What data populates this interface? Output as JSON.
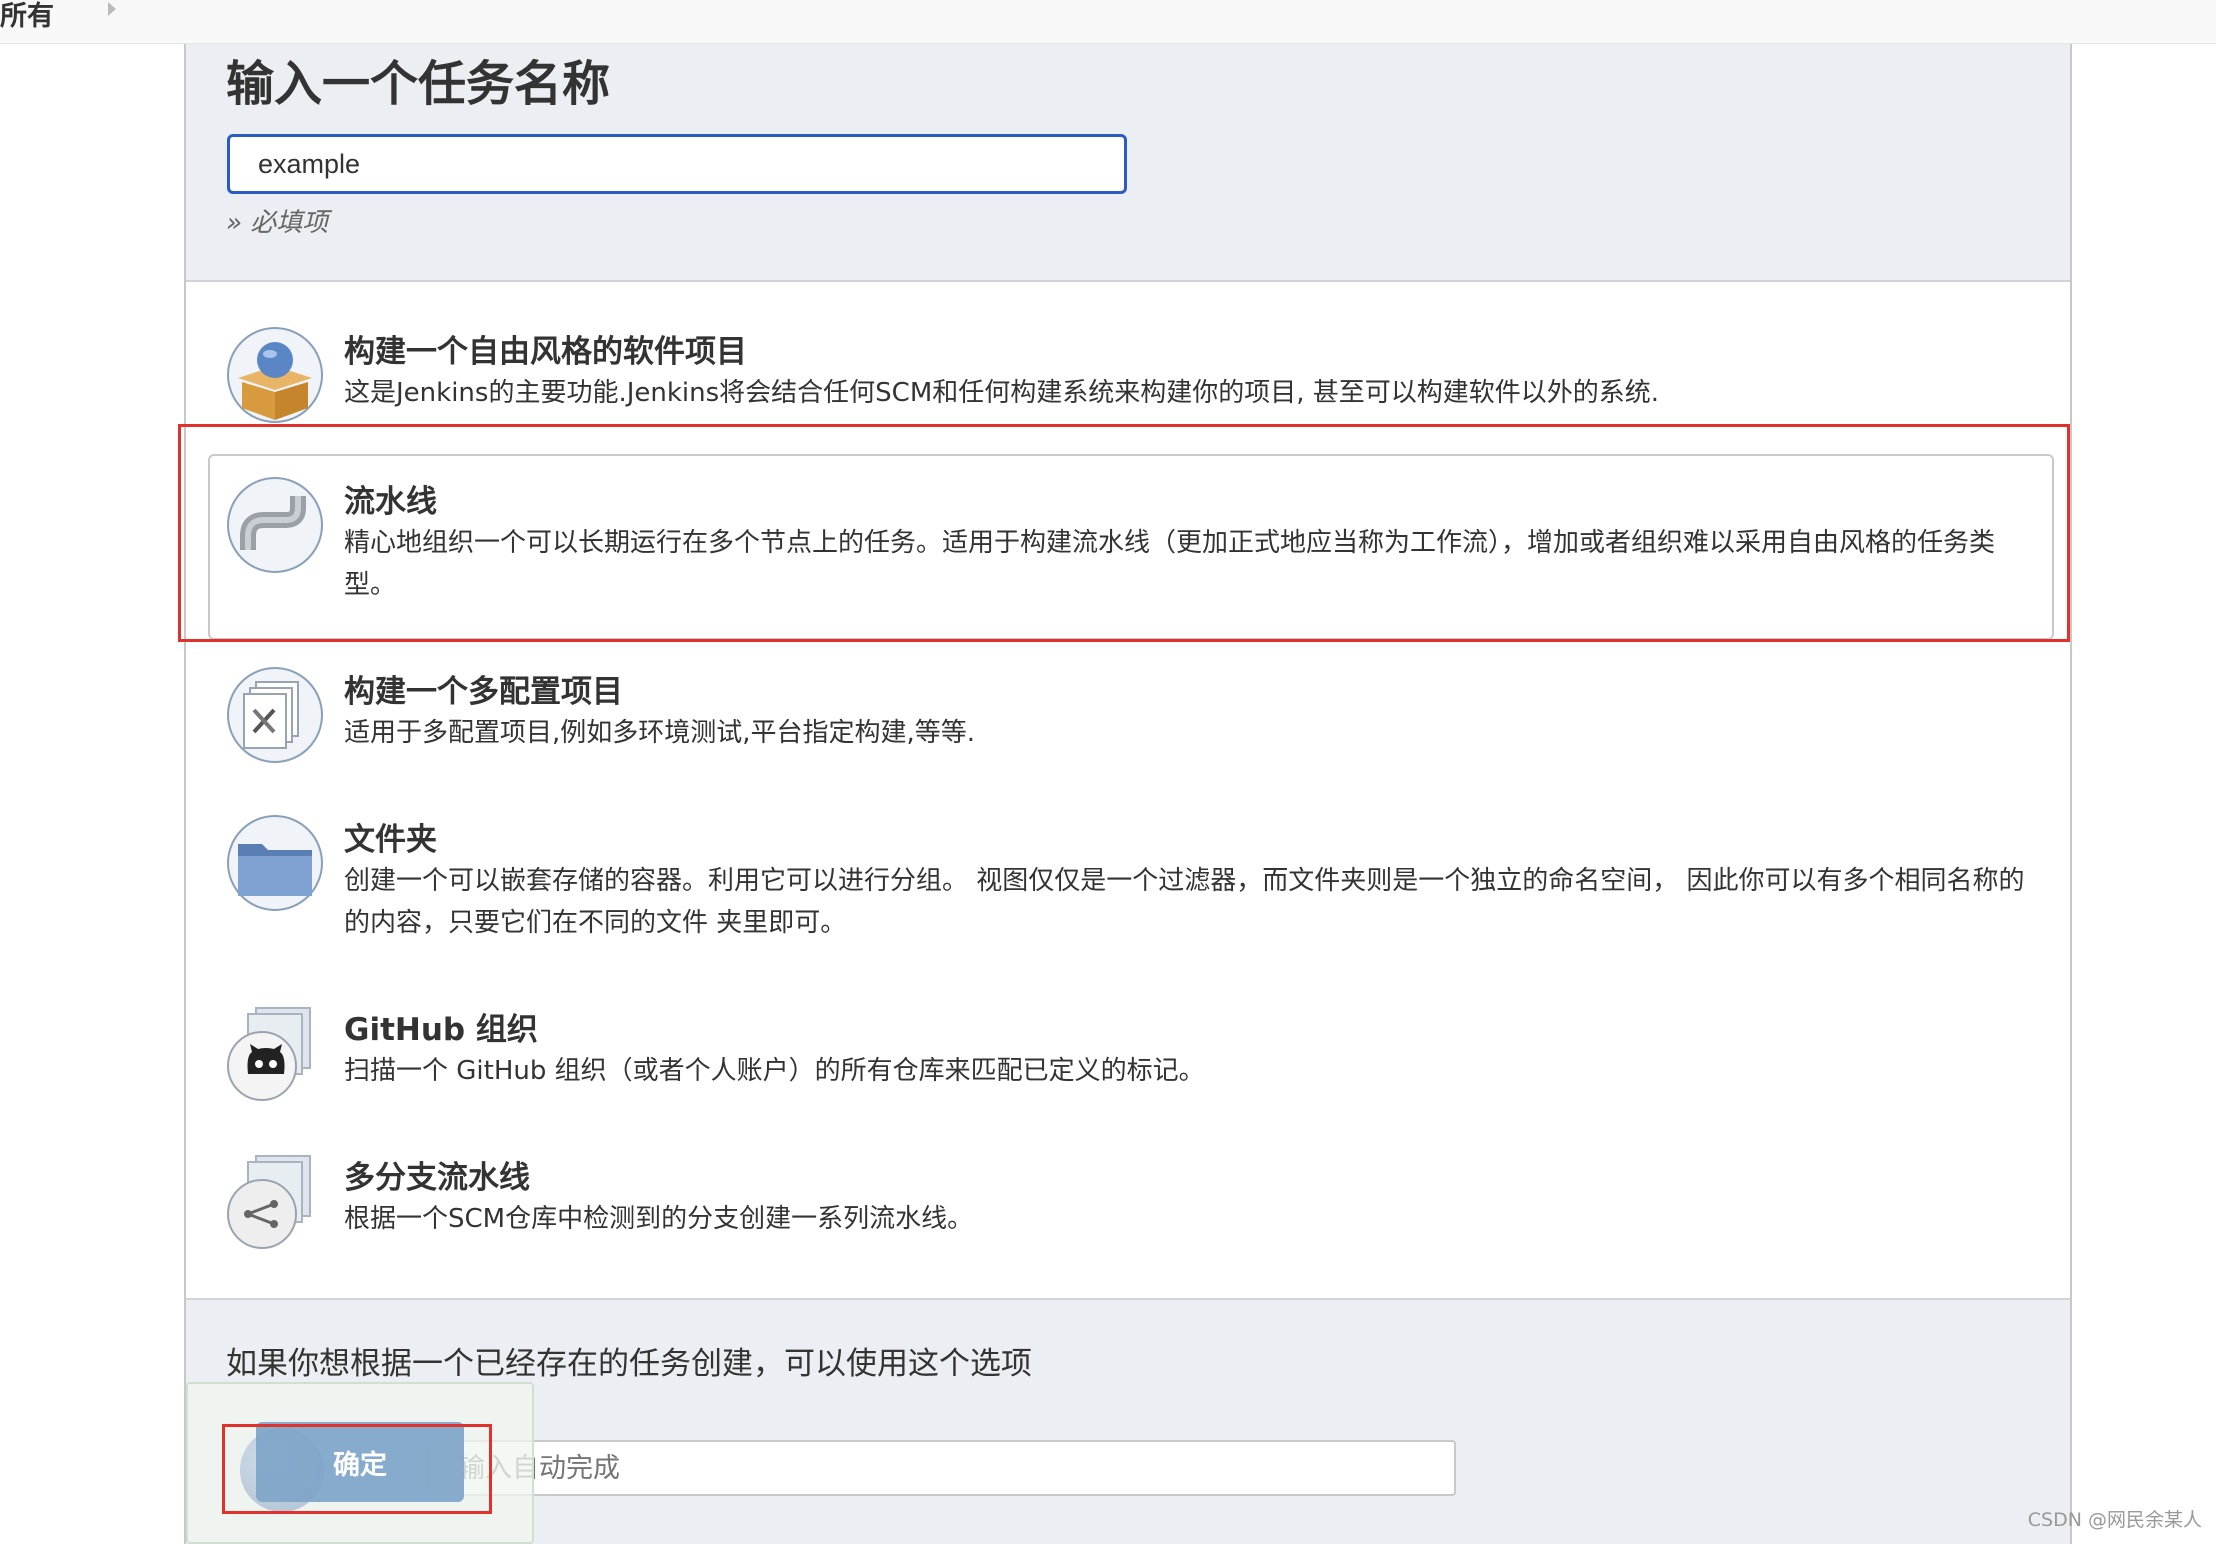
{
  "breadcrumb": {
    "label": "所有"
  },
  "page_title": "输入一个任务名称",
  "name_input": {
    "value": "example"
  },
  "required_hint": "» 必填项",
  "items": [
    {
      "title": "构建一个自由风格的软件项目",
      "desc": "这是Jenkins的主要功能.Jenkins将会结合任何SCM和任何构建系统来构建你的项目, 甚至可以构建软件以外的系统.",
      "icon": "freestyle-box-icon"
    },
    {
      "title": "流水线",
      "desc": "精心地组织一个可以长期运行在多个节点上的任务。适用于构建流水线（更加正式地应当称为工作流），增加或者组织难以采用自由风格的任务类型。",
      "icon": "pipe-icon"
    },
    {
      "title": "构建一个多配置项目",
      "desc": "适用于多配置项目,例如多环境测试,平台指定构建,等等.",
      "icon": "multi-config-icon"
    },
    {
      "title": "文件夹",
      "desc": "创建一个可以嵌套存储的容器。利用它可以进行分组。 视图仅仅是一个过滤器，而文件夹则是一个独立的命名空间， 因此你可以有多个相同名称的的内容，只要它们在不同的文件 夹里即可。",
      "icon": "folder-icon"
    },
    {
      "title": "GitHub 组织",
      "desc": "扫描一个 GitHub 组织（或者个人账户）的所有仓库来匹配已定义的标记。",
      "icon": "github-org-icon"
    },
    {
      "title": "多分支流水线",
      "desc": "根据一个SCM仓库中检测到的分支创建一系列流水线。",
      "icon": "multibranch-icon"
    }
  ],
  "copy_section": {
    "label": "如果你想根据一个已经存在的任务创建，可以使用这个选项",
    "placeholder": "输入自动完成"
  },
  "ok_button": "确定",
  "watermark": "CSDN @网民余某人"
}
